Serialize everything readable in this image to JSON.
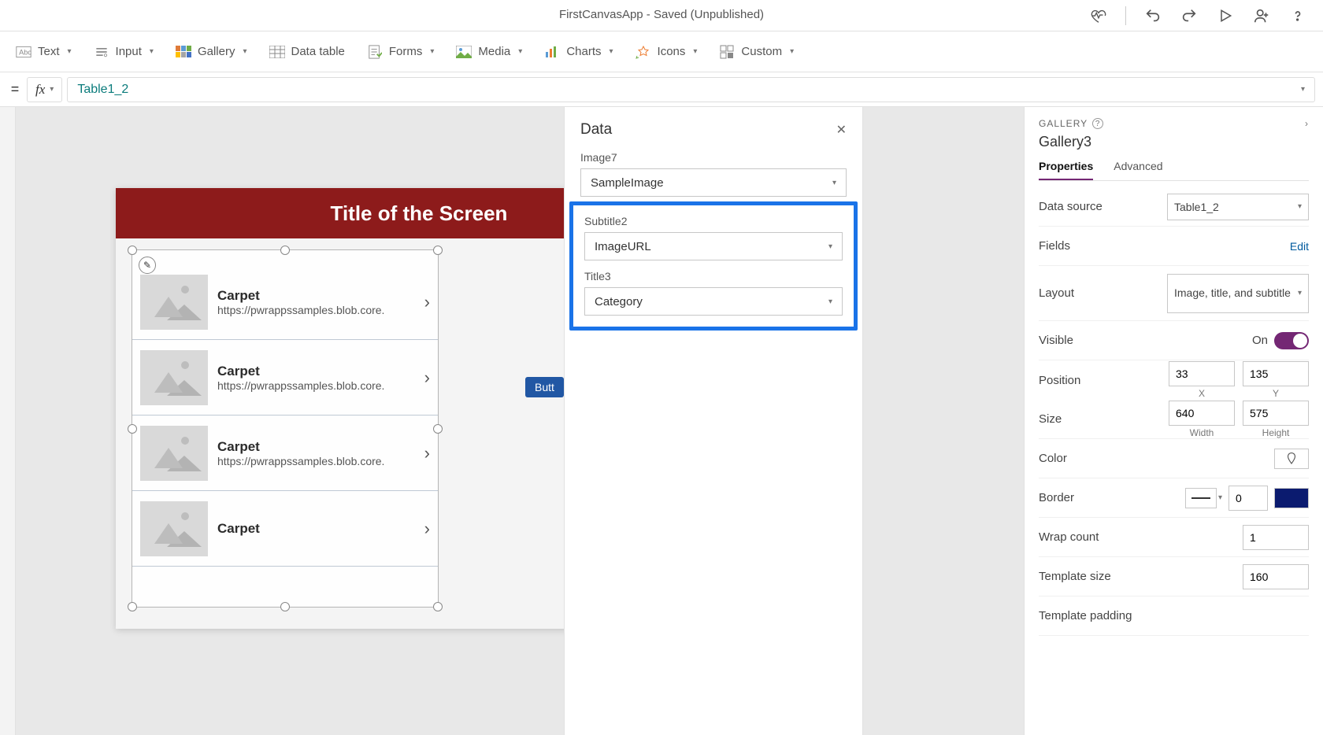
{
  "titlebar": {
    "text": "FirstCanvasApp - Saved (Unpublished)"
  },
  "ribbon": {
    "text": "Text",
    "input": "Input",
    "gallery": "Gallery",
    "data_table": "Data table",
    "forms": "Forms",
    "media": "Media",
    "charts": "Charts",
    "icons": "Icons",
    "custom": "Custom"
  },
  "formula": {
    "value": "Table1_2"
  },
  "canvas": {
    "screen_title": "Title of the Screen",
    "button_label": "Butt",
    "gallery_items": [
      {
        "title": "Carpet",
        "subtitle": "https://pwrappssamples.blob.core."
      },
      {
        "title": "Carpet",
        "subtitle": "https://pwrappssamples.blob.core."
      },
      {
        "title": "Carpet",
        "subtitle": "https://pwrappssamples.blob.core."
      },
      {
        "title": "Carpet",
        "subtitle": ""
      }
    ]
  },
  "data_panel": {
    "title": "Data",
    "fields": {
      "image_label": "Image7",
      "image_value": "SampleImage",
      "subtitle_label": "Subtitle2",
      "subtitle_value": "ImageURL",
      "title_label": "Title3",
      "title_value": "Category"
    }
  },
  "props": {
    "crumb": "GALLERY",
    "name": "Gallery3",
    "tabs": {
      "properties": "Properties",
      "advanced": "Advanced"
    },
    "data_source": {
      "label": "Data source",
      "value": "Table1_2"
    },
    "fields": {
      "label": "Fields",
      "edit": "Edit"
    },
    "layout": {
      "label": "Layout",
      "value": "Image, title, and subtitle"
    },
    "visible": {
      "label": "Visible",
      "value": "On"
    },
    "position": {
      "label": "Position",
      "x": "33",
      "y": "135",
      "xl": "X",
      "yl": "Y"
    },
    "size": {
      "label": "Size",
      "w": "640",
      "h": "575",
      "wl": "Width",
      "hl": "Height"
    },
    "color": {
      "label": "Color"
    },
    "border": {
      "label": "Border",
      "value": "0"
    },
    "wrap": {
      "label": "Wrap count",
      "value": "1"
    },
    "template_size": {
      "label": "Template size",
      "value": "160"
    },
    "template_padding": {
      "label": "Template padding"
    }
  }
}
